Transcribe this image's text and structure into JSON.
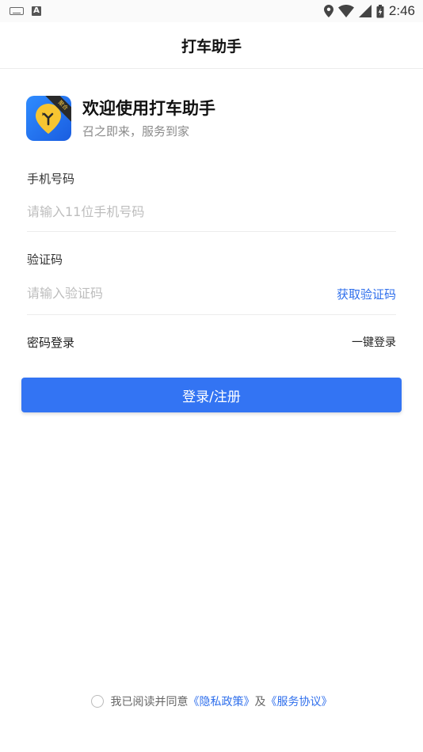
{
  "status_bar": {
    "time": "2:46",
    "left_icons": [
      "keyboard-icon",
      "a-icon"
    ],
    "right_icons": [
      "location-icon",
      "wifi-icon",
      "signal-icon",
      "battery-icon"
    ]
  },
  "header": {
    "title": "打车助手"
  },
  "welcome": {
    "title": "欢迎使用打车助手",
    "subtitle": "召之即来，服务到家",
    "logo_badge": "聚合"
  },
  "form": {
    "phone_label": "手机号码",
    "phone_placeholder": "请输入11位手机号码",
    "phone_value": "",
    "code_label": "验证码",
    "code_placeholder": "请输入验证码",
    "code_value": "",
    "get_code": "获取验证码",
    "password_login": "密码登录",
    "one_click_login": "一键登录",
    "submit": "登录/注册"
  },
  "agreement": {
    "prefix": "我已阅读并同意",
    "privacy": "《隐私政策》",
    "and": "及",
    "service": "《服务协议》",
    "checked": false
  },
  "colors": {
    "accent": "#3374f3",
    "link": "#2f6fec"
  }
}
